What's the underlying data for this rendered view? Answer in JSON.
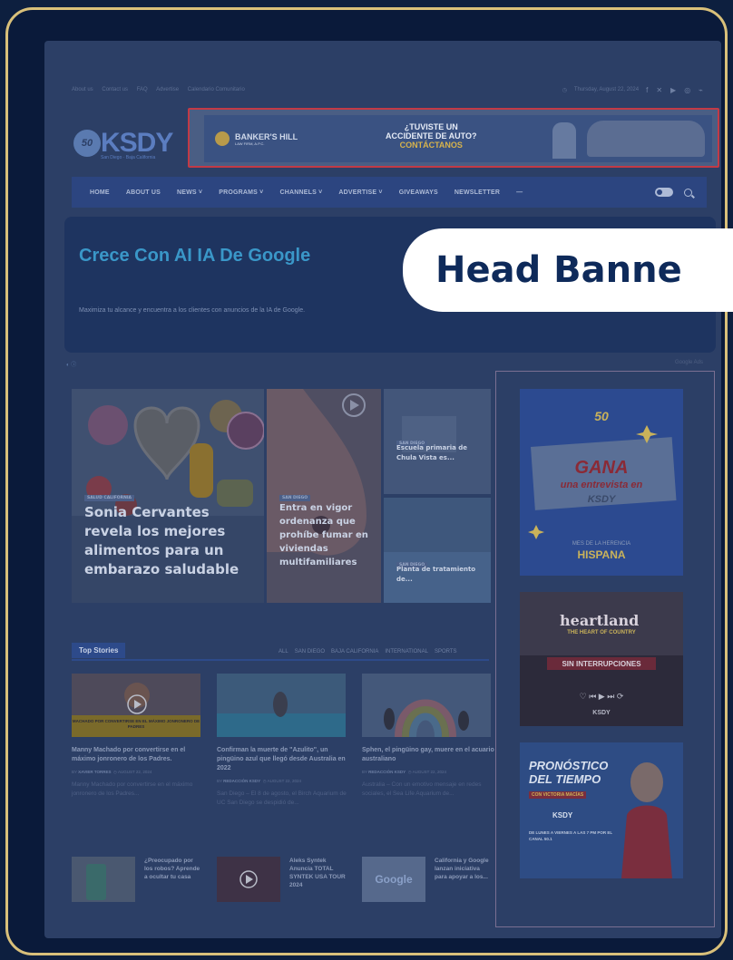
{
  "topbar": {
    "links": [
      "About us",
      "Contact us",
      "FAQ",
      "Advertise",
      "Calendario Comunitario"
    ],
    "date": "Thursday, August 22, 2024",
    "social": [
      "f",
      "✕",
      "▶",
      "◎",
      "⌁"
    ]
  },
  "logo": {
    "number": "50",
    "name": "KSDY",
    "tagline": "San Diego · Baja California"
  },
  "ad": {
    "brand": "BANKER'S HILL",
    "brand_sub": "LAW FIRM, A.P.C.",
    "line1": "¿TUVISTE UN",
    "line2": "ACCIDENTE DE AUTO?",
    "cta": "CONTÁCTANOS"
  },
  "nav": {
    "items": [
      "HOME",
      "ABOUT US",
      "NEWS ˅",
      "PROGRAMS ˅",
      "CHANNELS ˅",
      "ADVERTISE ˅",
      "GIVEAWAYS",
      "NEWSLETTER",
      "—"
    ]
  },
  "hero": {
    "title": "Crece Con AI IA De Google",
    "text": "Maximiza tu alcance y encuentra a los clientes con anuncios de la IA de Google.",
    "by": "Google Ads"
  },
  "features": [
    {
      "tag": "SALUD CALIFORNIA",
      "title": "Sonia Cervantes revela los mejores alimentos para un embarazo saludable"
    },
    {
      "tag": "SAN DIEGO",
      "title": "Entra en vigor ordenanza que prohíbe fumar en viviendas multifamiliares"
    },
    {
      "tag": "SAN DIEGO",
      "title": "Escuela primaria de Chula Vista es..."
    },
    {
      "tag": "SAN DIEGO",
      "title": "Planta de tratamiento de..."
    }
  ],
  "side": {
    "gana": {
      "number": "50",
      "title": "GANA",
      "sub": "una entrevista en",
      "brand": "KSDY",
      "line": "MES DE LA HERENCIA",
      "big": "HISPANA"
    },
    "heartland": {
      "name": "heartland",
      "sub": "THE HEART OF COUNTRY",
      "band": "SIN INTERRUPCIONES",
      "brand": "KSDY"
    },
    "weather": {
      "title": "PRONÓSTICO DEL TIEMPO",
      "host": "CON VICTORIA MACÍAS",
      "brand": "KSDY",
      "schedule": "DE LUNES A VIERNES A LAS 7 PM POR EL CANAL 50.1"
    }
  },
  "top_stories": {
    "label": "Top Stories",
    "tabs": [
      "ALL",
      "SAN DIEGO",
      "BAJA CALIFORNIA",
      "INTERNATIONAL",
      "SPORTS"
    ],
    "stories": [
      {
        "caption": "MACHADO POR CONVERTIRSE EN EL MÁXIMO JONRONERO DE PADRES",
        "title": "Manny Machado por convertirse en el máximo jonronero de los Padres.",
        "author": "XAVIER TORRES",
        "date": "AUGUST 22, 2024",
        "excerpt": "Manny Machado por convertirse en el máximo jonronero de los Padres..."
      },
      {
        "title": "Confirman la muerte de \"Azulito\", un pingüino azul que llegó desde Australia en 2022",
        "author": "REDACCIÓN KSDY",
        "date": "AUGUST 22, 2024",
        "excerpt": "San Diego – El 8 de agosto, el Birch Aquarium de UC San Diego se despidió de..."
      },
      {
        "title": "Sphen, el pingüino gay, muere en el acuario australiano",
        "author": "REDACCIÓN KSDY",
        "date": "AUGUST 22, 2024",
        "excerpt": "Australia – Con un emotivo mensaje en redes sociales, el Sea Life Aquarium de..."
      }
    ],
    "mini": [
      {
        "title": "¿Preocupado por los robos? Aprende a ocultar tu casa"
      },
      {
        "title": "Aleks Syntek Anuncia TOTAL SYNTEK USA TOUR 2024"
      },
      {
        "thumb": "Google",
        "title": "California y Google lanzan iniciativa para apoyar a los..."
      }
    ]
  },
  "overlay": {
    "label": "Head Banne"
  }
}
